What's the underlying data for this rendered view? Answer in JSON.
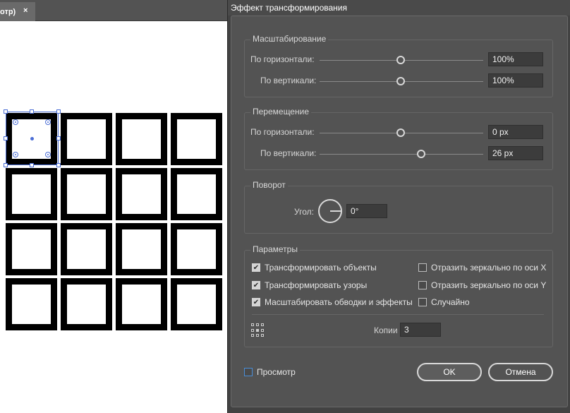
{
  "document_tab": {
    "label": "отр)",
    "close_glyph": "×"
  },
  "dialog": {
    "title": "Эффект трансформирования",
    "scale": {
      "legend": "Масштабирование",
      "horizontal_label": "По горизонтали:",
      "horizontal_value": "100%",
      "vertical_label": "По вертикали:",
      "vertical_value": "100%"
    },
    "move": {
      "legend": "Перемещение",
      "horizontal_label": "По горизонтали:",
      "horizontal_value": "0 px",
      "vertical_label": "По вертикали:",
      "vertical_value": "26 px"
    },
    "rotate": {
      "legend": "Поворот",
      "angle_label": "Угол:",
      "angle_value": "0°"
    },
    "options": {
      "legend": "Параметры",
      "transform_objects": "Трансформировать объекты",
      "transform_patterns": "Трансформировать узоры",
      "scale_strokes": "Масштабировать обводки и эффекты",
      "reflect_x": "Отразить зеркально по оси X",
      "reflect_y": "Отразить зеркально по оси Y",
      "random": "Случайно",
      "copies_label": "Копии",
      "copies_value": "3"
    },
    "preview_label": "Просмотр",
    "ok_label": "OK",
    "cancel_label": "Отмена"
  },
  "checkbox_states": {
    "transform_objects": true,
    "transform_patterns": true,
    "scale_strokes": true,
    "reflect_x": false,
    "reflect_y": false,
    "random": false,
    "preview": false
  },
  "icons": [
    "close-icon",
    "checkmark-icon",
    "angle-dial-icon",
    "reference-point-icon",
    "selection-handle-icon"
  ],
  "colors": {
    "dialog_bg": "#535353",
    "selection": "#4b6ed6",
    "tile_stroke": "#000000"
  }
}
